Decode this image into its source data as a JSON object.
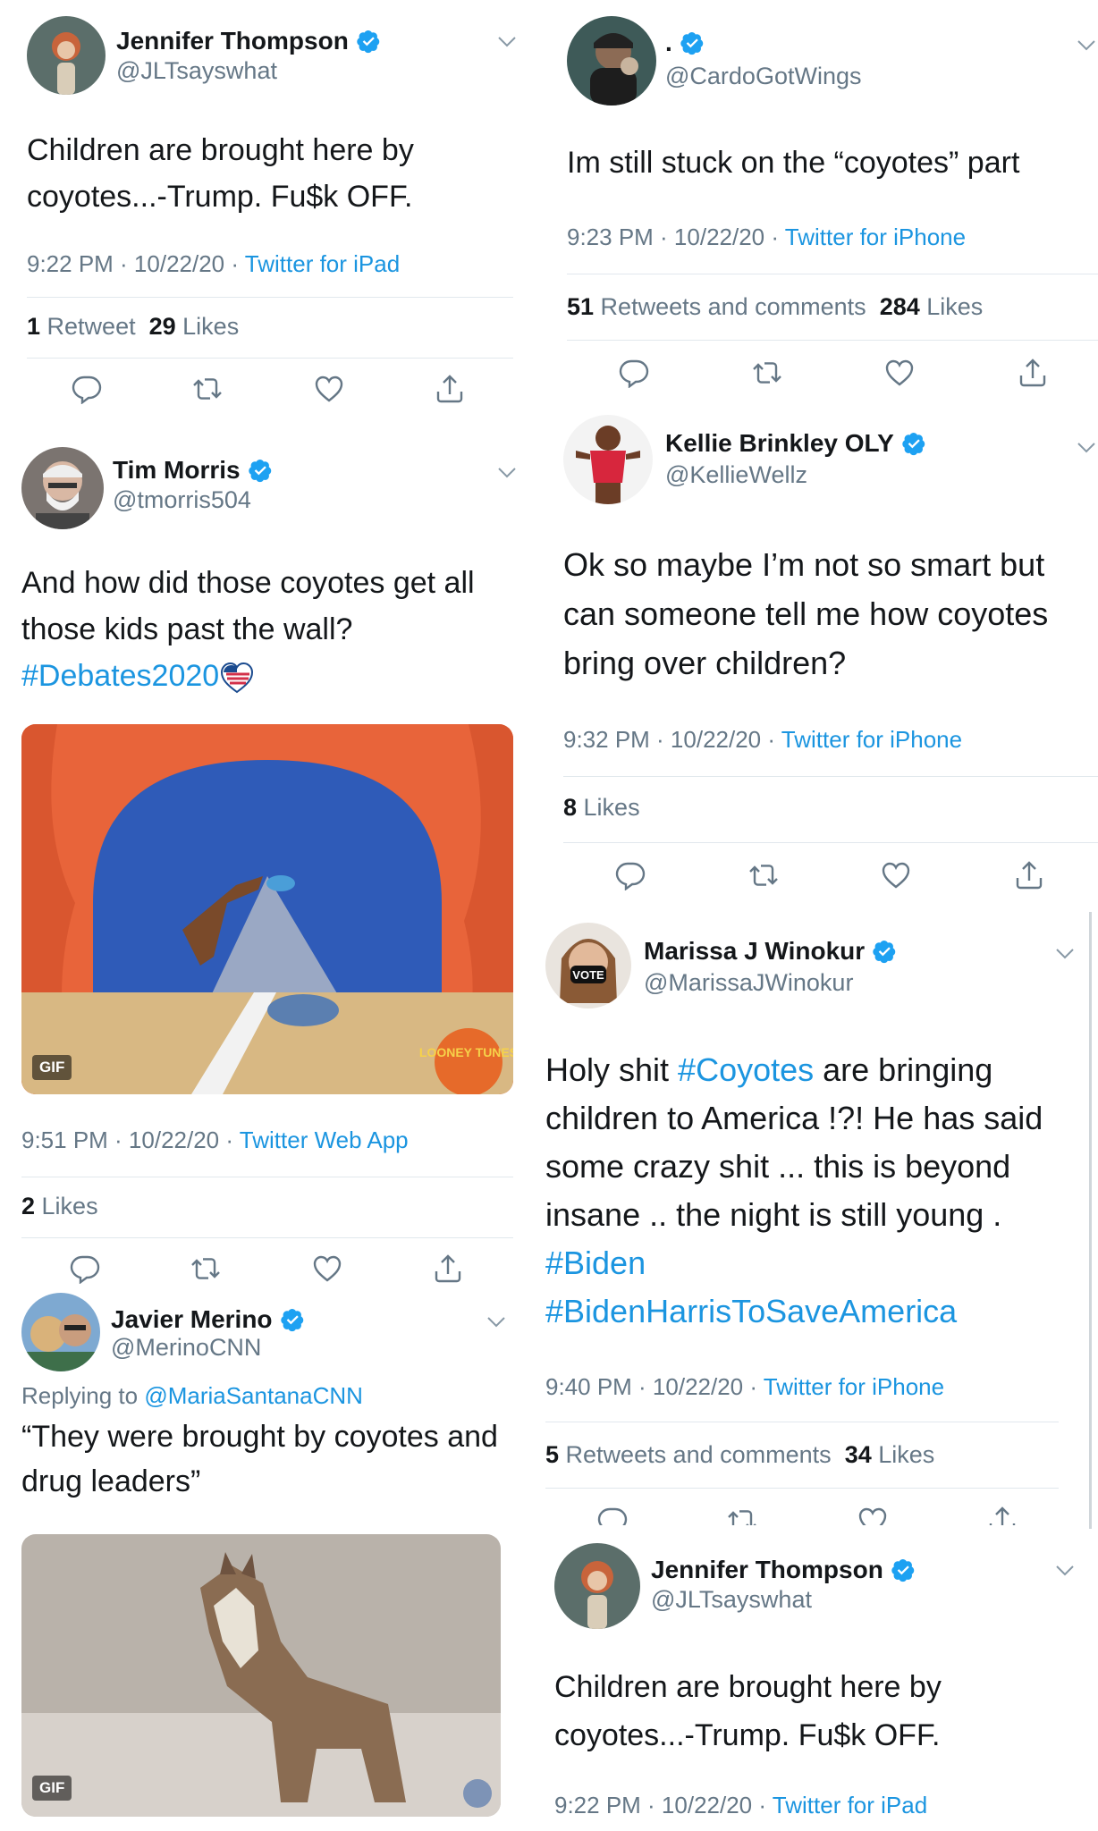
{
  "tweets": [
    {
      "name": "Jennifer Thompson",
      "handle": "@JLTsayswhat",
      "text_lines": [
        "Children are brought here by",
        "coyotes...-Trump. Fu$k OFF."
      ],
      "time": "9:22 PM · 10/22/20 · ",
      "source": "Twitter for iPad",
      "stat1_num": "1",
      "stat1_label": " Retweet",
      "stat2_num": "29",
      "stat2_label": " Likes"
    },
    {
      "name": ".",
      "handle": "@CardoGotWings",
      "text_lines": [
        "Im still stuck on the “coyotes” part"
      ],
      "time": "9:23 PM · 10/22/20 · ",
      "source": "Twitter for iPhone",
      "stat1_num": "51",
      "stat1_label": " Retweets and comments",
      "stat2_num": "284",
      "stat2_label": " Likes"
    },
    {
      "name": "Tim Morris",
      "handle": "@tmorris504",
      "text_lines": [
        "And how did those coyotes get all",
        "those kids past the wall?"
      ],
      "hashtag": "#Debates2020",
      "media_badge": "GIF",
      "media_logo": "LOONEY TUNES",
      "time": "9:51 PM · 10/22/20 · ",
      "source": "Twitter Web App",
      "stat1_num": "2",
      "stat1_label": " Likes"
    },
    {
      "name": "Kellie Brinkley OLY",
      "handle": "@KellieWellz",
      "text_lines": [
        "Ok so maybe I’m not so smart but",
        "can someone tell me how coyotes",
        "bring over children?"
      ],
      "time": "9:32 PM · 10/22/20 · ",
      "source": "Twitter for iPhone",
      "stat1_num": "8",
      "stat1_label": " Likes"
    },
    {
      "name": "Marissa J Winokur",
      "handle": "@MarissaJWinokur",
      "line1_pre": "Holy shit ",
      "line1_tag": "#Coyotes",
      "line1_post": " are bringing",
      "line2": "children to America !?! He has said",
      "line3": "some crazy shit ... this is beyond",
      "line4": "insane .. the night is still young .",
      "tag1": "#Biden",
      "tag2": "#BidenHarrisToSaveAmerica",
      "avatar_mask_text": "VOTE",
      "time": "9:40 PM · 10/22/20 · ",
      "source": "Twitter for iPhone",
      "stat1_num": "5",
      "stat1_label": " Retweets and comments",
      "stat2_num": "34",
      "stat2_label": " Likes"
    },
    {
      "name": "Javier Merino",
      "handle": "@MerinoCNN",
      "replying_prefix": "Replying to ",
      "replying_handle": "@MariaSantanaCNN",
      "text_lines": [
        "“They were brought by coyotes and",
        "drug leaders”"
      ],
      "media_badge": "GIF"
    },
    {
      "name": "Jennifer Thompson",
      "handle": "@JLTsayswhat",
      "text_lines": [
        "Children are brought here by",
        "coyotes...-Trump. Fu$k OFF."
      ],
      "time": "9:22 PM · 10/22/20 · ",
      "source": "Twitter for iPad"
    }
  ],
  "colors": {
    "link": "#1b95e0",
    "secondary": "#657786",
    "divider": "#e1e8ed",
    "verified": "#1da1f2"
  },
  "icons": [
    "reply-icon",
    "retweet-icon",
    "like-icon",
    "share-icon",
    "verified-badge-icon",
    "chevron-down-icon",
    "us-flag-heart-icon"
  ]
}
